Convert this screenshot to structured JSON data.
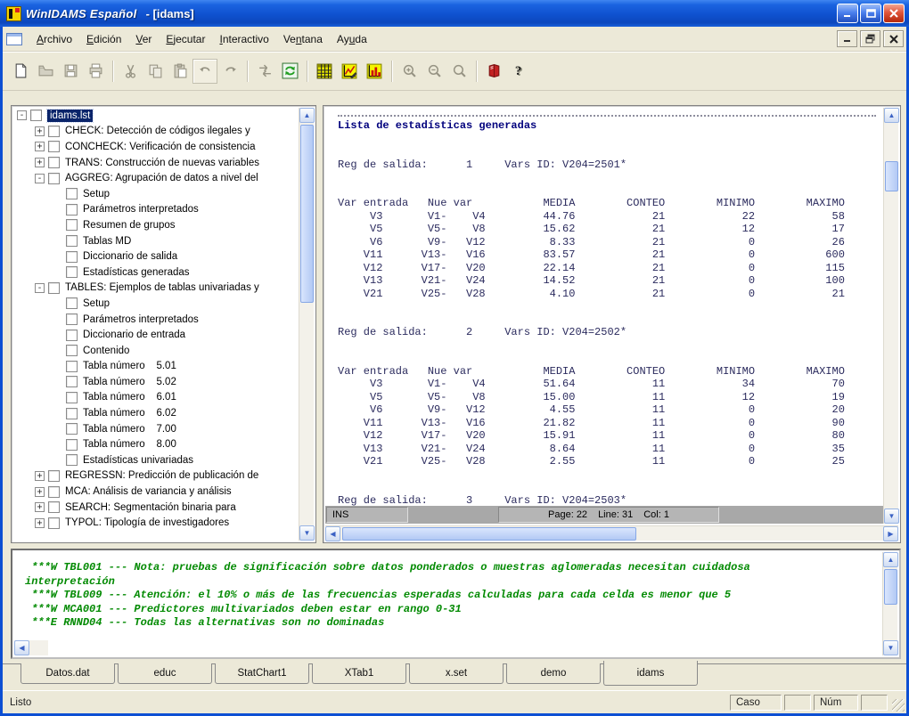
{
  "window": {
    "app_title": "WinIDAMS Español",
    "doc_title": "- [idams]"
  },
  "menu": {
    "items": [
      {
        "label": "Archivo",
        "u": 0
      },
      {
        "label": "Edición",
        "u": 0
      },
      {
        "label": "Ver",
        "u": 0
      },
      {
        "label": "Ejecutar",
        "u": 0
      },
      {
        "label": "Interactivo",
        "u": 0
      },
      {
        "label": "Ventana",
        "u": 2
      },
      {
        "label": "Ayuda",
        "u": 2
      }
    ]
  },
  "toolbar": {
    "icons": [
      "new-document",
      "open-folder",
      "save",
      "print",
      "cut",
      "copy",
      "paste",
      "undo",
      "redo",
      "exchange",
      "refresh",
      "data-table",
      "chart-line",
      "chart-bars",
      "zoom-in",
      "zoom-out",
      "zoom",
      "help-book",
      "help-question"
    ]
  },
  "tree": {
    "items": [
      {
        "label": "idams.lst",
        "level": 0,
        "expand": "minus",
        "selected": true
      },
      {
        "label": "CHECK: Detección de códigos ilegales y",
        "level": 1,
        "expand": "plus"
      },
      {
        "label": "CONCHECK: Verificación de consistencia",
        "level": 1,
        "expand": "plus"
      },
      {
        "label": "TRANS: Construcción de nuevas variables",
        "level": 1,
        "expand": "plus"
      },
      {
        "label": "AGGREG: Agrupación de datos a nivel del",
        "level": 1,
        "expand": "minus"
      },
      {
        "label": "Setup",
        "level": 2
      },
      {
        "label": "Parámetros interpretados",
        "level": 2
      },
      {
        "label": "Resumen de grupos",
        "level": 2
      },
      {
        "label": "Tablas MD",
        "level": 2
      },
      {
        "label": "Diccionario de salida",
        "level": 2
      },
      {
        "label": "Estadísticas generadas",
        "level": 2
      },
      {
        "label": "TABLES: Ejemplos de tablas univariadas y",
        "level": 1,
        "expand": "minus"
      },
      {
        "label": "Setup",
        "level": 2
      },
      {
        "label": "Parámetros interpretados",
        "level": 2
      },
      {
        "label": "Diccionario de entrada",
        "level": 2
      },
      {
        "label": "Contenido",
        "level": 2
      },
      {
        "label": "Tabla número    5.01",
        "level": 2
      },
      {
        "label": "Tabla número    5.02",
        "level": 2
      },
      {
        "label": "Tabla número    6.01",
        "level": 2
      },
      {
        "label": "Tabla número    6.02",
        "level": 2
      },
      {
        "label": "Tabla número    7.00",
        "level": 2
      },
      {
        "label": "Tabla número    8.00",
        "level": 2
      },
      {
        "label": "Estadísticas univariadas",
        "level": 2
      },
      {
        "label": "REGRESSN: Predicción de publicación de",
        "level": 1,
        "expand": "plus"
      },
      {
        "label": "MCA: Análisis de variancia y análisis",
        "level": 1,
        "expand": "plus"
      },
      {
        "label": "SEARCH: Segmentación binaria para",
        "level": 1,
        "expand": "plus"
      },
      {
        "label": "TYPOL: Tipología de investigadores",
        "level": 1,
        "expand": "plus"
      }
    ]
  },
  "output": {
    "title": "Lista de estadísticas generadas",
    "reg_label": "Reg de salida:",
    "vars_label": "Vars ID:",
    "columns": [
      "Var entrada",
      "Nue var",
      "MEDIA",
      "CONTEO",
      "MINIMO",
      "MAXIMO"
    ],
    "blocks": [
      {
        "reg": "1",
        "vars_id": "V204=2501*",
        "rows": [
          [
            "V3",
            "V1-",
            "V4",
            "44.76",
            "21",
            "22",
            "58"
          ],
          [
            "V5",
            "V5-",
            "V8",
            "15.62",
            "21",
            "12",
            "17"
          ],
          [
            "V6",
            "V9-",
            "V12",
            "8.33",
            "21",
            "0",
            "26"
          ],
          [
            "V11",
            "V13-",
            "V16",
            "83.57",
            "21",
            "0",
            "600"
          ],
          [
            "V12",
            "V17-",
            "V20",
            "22.14",
            "21",
            "0",
            "115"
          ],
          [
            "V13",
            "V21-",
            "V24",
            "14.52",
            "21",
            "0",
            "100"
          ],
          [
            "V21",
            "V25-",
            "V28",
            "4.10",
            "21",
            "0",
            "21"
          ]
        ]
      },
      {
        "reg": "2",
        "vars_id": "V204=2502*",
        "rows": [
          [
            "V3",
            "V1-",
            "V4",
            "51.64",
            "11",
            "34",
            "70"
          ],
          [
            "V5",
            "V5-",
            "V8",
            "15.00",
            "11",
            "12",
            "19"
          ],
          [
            "V6",
            "V9-",
            "V12",
            "4.55",
            "11",
            "0",
            "20"
          ],
          [
            "V11",
            "V13-",
            "V16",
            "21.82",
            "11",
            "0",
            "90"
          ],
          [
            "V12",
            "V17-",
            "V20",
            "15.91",
            "11",
            "0",
            "80"
          ],
          [
            "V13",
            "V21-",
            "V24",
            "8.64",
            "11",
            "0",
            "35"
          ],
          [
            "V21",
            "V25-",
            "V28",
            "2.55",
            "11",
            "0",
            "25"
          ]
        ]
      },
      {
        "reg": "3",
        "vars_id": "V204=2503*",
        "rows": []
      }
    ],
    "status": {
      "mode": "INS",
      "page": "Page: 22",
      "line": "Line: 31",
      "col": "Col: 1"
    }
  },
  "messages": {
    "lines": [
      " ***W TBL001 --- Nota: pruebas de significación sobre datos ponderados o muestras aglomeradas necesitan cuidadosa interpretación",
      " ***W TBL009 --- Atención: el 10% o más de las frecuencias esperadas calculadas para cada celda es menor que 5",
      " ***W MCA001 --- Predictores multivariados deben estar en rango 0-31",
      " ***E RNND04 --- Todas las alternativas son no dominadas"
    ]
  },
  "tabs": {
    "items": [
      "Datos.dat",
      "educ",
      "StatChart1",
      "XTab1",
      "x.set",
      "demo",
      "idams"
    ],
    "active_index": 6
  },
  "statusbar": {
    "left": "Listo",
    "caso_label": "Caso",
    "num_label": "Núm"
  },
  "colors": {
    "titlebar_blue": "#1458d0",
    "selection_navy": "#0a246a",
    "message_green": "#028a02",
    "output_navy": "#2b2b5e",
    "client_bg": "#ECE9D8",
    "accent_yellow": "#f5f500"
  }
}
